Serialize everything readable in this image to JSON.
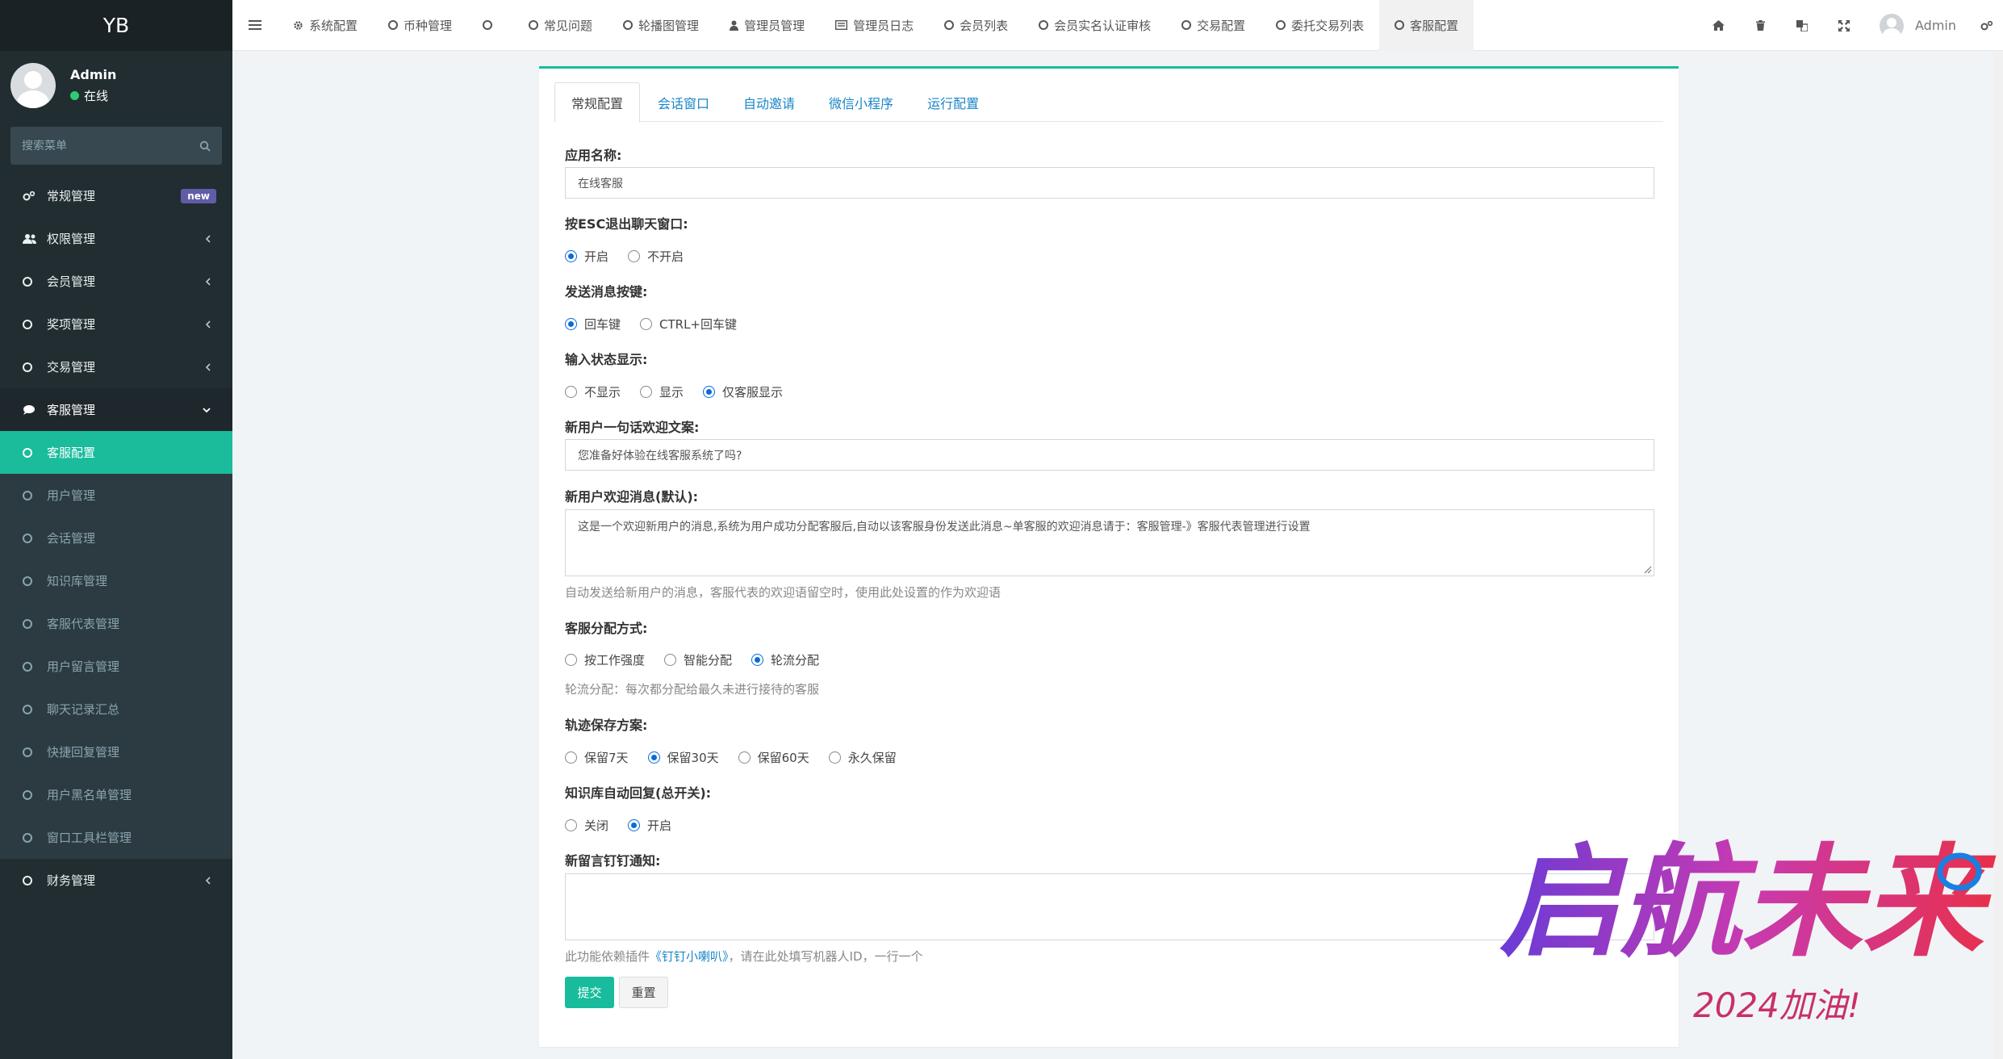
{
  "sidebar": {
    "brand": "YB",
    "user": {
      "name": "Admin",
      "status": "在线"
    },
    "search_placeholder": "搜索菜单",
    "new_badge": "new",
    "items": [
      {
        "label": "常规管理"
      },
      {
        "label": "权限管理"
      },
      {
        "label": "会员管理"
      },
      {
        "label": "奖项管理"
      },
      {
        "label": "交易管理"
      },
      {
        "label": "客服管理"
      }
    ],
    "sub_items": [
      {
        "label": "客服配置"
      },
      {
        "label": "用户管理"
      },
      {
        "label": "会话管理"
      },
      {
        "label": "知识库管理"
      },
      {
        "label": "客服代表管理"
      },
      {
        "label": "用户留言管理"
      },
      {
        "label": "聊天记录汇总"
      },
      {
        "label": "快捷回复管理"
      },
      {
        "label": "用户黑名单管理"
      },
      {
        "label": "窗口工具栏管理"
      }
    ],
    "finance": {
      "label": "财务管理"
    }
  },
  "topbar": {
    "tabs": [
      {
        "label": "系统配置"
      },
      {
        "label": "币种管理"
      },
      {
        "label": ""
      },
      {
        "label": "常见问题"
      },
      {
        "label": "轮播图管理"
      },
      {
        "label": "管理员管理"
      },
      {
        "label": "管理员日志"
      },
      {
        "label": "会员列表"
      },
      {
        "label": "会员实名认证审核"
      },
      {
        "label": "交易配置"
      },
      {
        "label": "委托交易列表"
      },
      {
        "label": "客服配置"
      }
    ],
    "user_name": "Admin"
  },
  "panel": {
    "tabs": [
      {
        "label": "常规配置"
      },
      {
        "label": "会话窗口"
      },
      {
        "label": "自动邀请"
      },
      {
        "label": "微信小程序"
      },
      {
        "label": "运行配置"
      }
    ],
    "app_name": {
      "label": "应用名称:",
      "value": "在线客服"
    },
    "esc_close": {
      "label": "按ESC退出聊天窗口:",
      "options": [
        "开启",
        "不开启"
      ],
      "selected": 0
    },
    "send_key": {
      "label": "发送消息按键:",
      "options": [
        "回车键",
        "CTRL+回车键"
      ],
      "selected": 0
    },
    "typing_state": {
      "label": "输入状态显示:",
      "options": [
        "不显示",
        "显示",
        "仅客服显示"
      ],
      "selected": 2
    },
    "welcome_line": {
      "label": "新用户一句话欢迎文案:",
      "value": "您准备好体验在线客服系统了吗?"
    },
    "welcome_msg": {
      "label": "新用户欢迎消息(默认):",
      "value": "这是一个欢迎新用户的消息,系统为用户成功分配客服后,自动以该客服身份发送此消息~单客服的欢迎消息请于：客服管理-》客服代表管理进行设置",
      "help": "自动发送给新用户的消息，客服代表的欢迎语留空时，使用此处设置的作为欢迎语"
    },
    "assign_mode": {
      "label": "客服分配方式:",
      "options": [
        "按工作强度",
        "智能分配",
        "轮流分配"
      ],
      "selected": 2,
      "help": "轮流分配：每次都分配给最久未进行接待的客服"
    },
    "trace_keep": {
      "label": "轨迹保存方案:",
      "options": [
        "保留7天",
        "保留30天",
        "保留60天",
        "永久保留"
      ],
      "selected": 1
    },
    "kb_autoreply": {
      "label": "知识库自动回复(总开关):",
      "options": [
        "关闭",
        "开启"
      ],
      "selected": 1
    },
    "dingtalk": {
      "label": "新留言钉钉通知:",
      "value": "",
      "help_prefix": "此功能依赖插件",
      "help_link": "《钉钉小喇叭》",
      "help_suffix": "，请在此处填写机器人ID，一行一个"
    },
    "submit_label": "提交",
    "reset_label": "重置"
  },
  "watermark": {
    "main": "启航未来",
    "sub": "2024加油!"
  },
  "colors": {
    "sidebar_bg": "#222d32",
    "accent": "#1abc9c",
    "link": "#1a86c8",
    "new_badge": "#605ca8"
  }
}
